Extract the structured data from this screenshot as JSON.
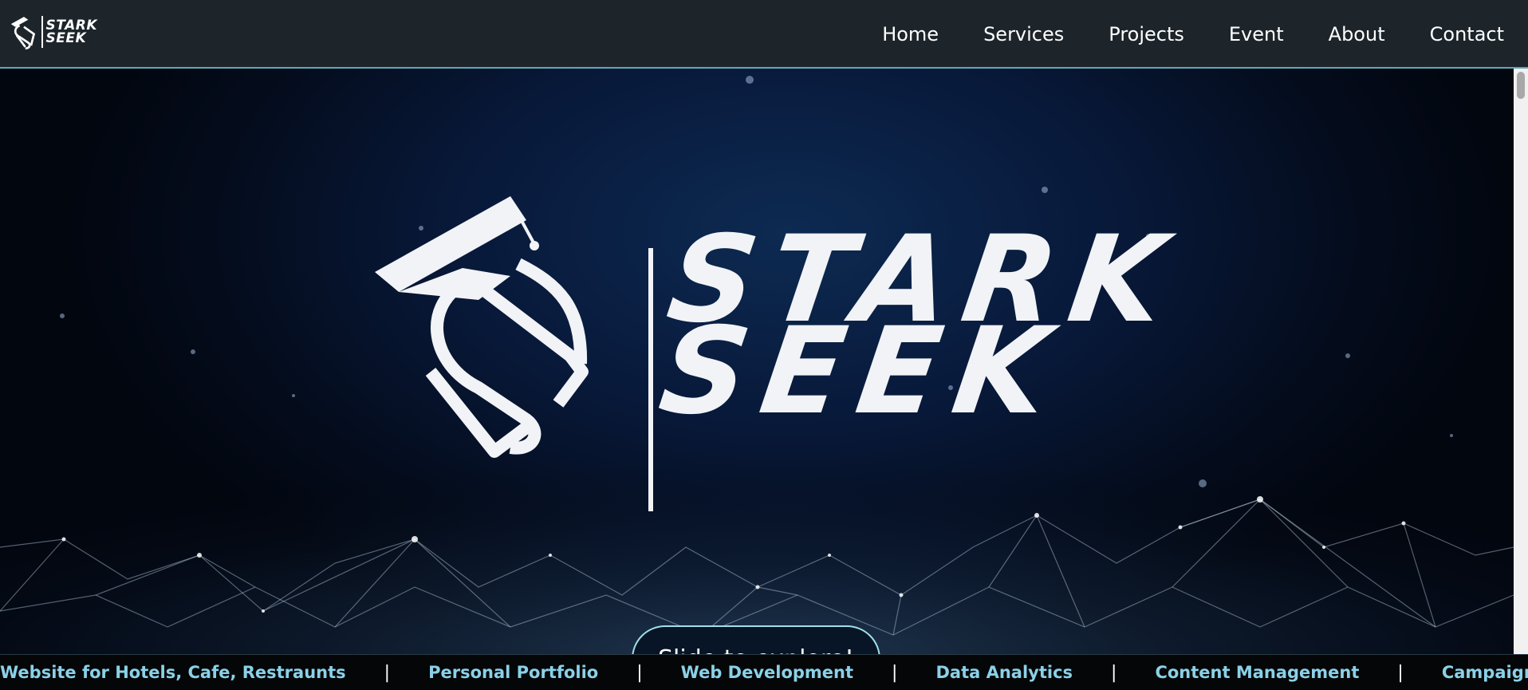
{
  "header": {
    "logo_text": "STARK\nSEEK",
    "nav": [
      {
        "label": "Home"
      },
      {
        "label": "Services"
      },
      {
        "label": "Projects"
      },
      {
        "label": "Event"
      },
      {
        "label": "About"
      },
      {
        "label": "Contact"
      }
    ]
  },
  "hero": {
    "brand_line1": "STARK",
    "brand_line2": "SEEK",
    "cta_label": "Slide to explore!"
  },
  "ticker": {
    "items": [
      "Website for Hotels, Cafe, Restraunts",
      "Personal Portfolio",
      "Web Development",
      "Data Analytics",
      "Content Management",
      "Campaign Management"
    ],
    "separator": "|"
  },
  "colors": {
    "navbar_bg": "#1d252b",
    "navbar_border": "#5fa9b6",
    "ticker_text": "#8ad1e8",
    "cta_border": "#9fdfe8"
  }
}
